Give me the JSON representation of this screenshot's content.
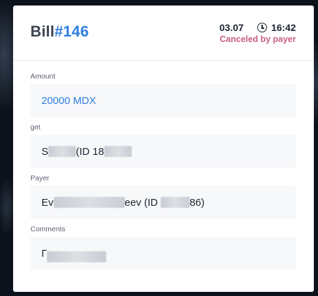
{
  "bill": {
    "prefix": "Bill",
    "number": "#146",
    "date": "03.07",
    "time": "16:42",
    "status": "Canceled by payer",
    "status_color": "#c75f7e",
    "accent_color": "#2d7ee0"
  },
  "fields": {
    "amount": {
      "label": "Amount",
      "value": "20000 MDX"
    },
    "get": {
      "label": "get",
      "value_start": "S",
      "value_mid": "(ID 18"
    },
    "payer": {
      "label": "Payer",
      "value_start": "Ev",
      "value_mid": "eev (ID",
      "value_end": "86)"
    },
    "comments": {
      "label": "Comments",
      "value_start": "Г"
    }
  },
  "icons": {
    "clock": "clock-icon"
  }
}
